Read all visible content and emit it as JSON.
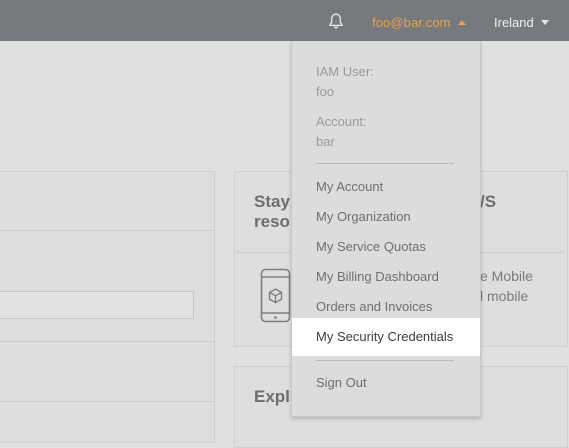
{
  "header": {
    "account_email": "foo@bar.com",
    "region": "Ireland",
    "icons": {
      "notifications": "bell-icon",
      "account_caret": "caret-up-icon",
      "region_caret": "caret-down-icon"
    },
    "colors": {
      "bar": "#76797d",
      "account": "#e3a253"
    }
  },
  "dropdown": {
    "iam_user_label": "IAM User:",
    "iam_user_value": "foo",
    "account_label": "Account:",
    "account_value": "bar",
    "items": [
      {
        "label": "My Account"
      },
      {
        "label": "My Organization"
      },
      {
        "label": "My Service Quotas"
      },
      {
        "label": "My Billing Dashboard"
      },
      {
        "label": "Orders and Invoices"
      },
      {
        "label": "My Security Credentials"
      }
    ],
    "sign_out": "Sign Out",
    "active_item": "My Security Credentials"
  },
  "background": {
    "card1_heading_line1": "Stay",
    "card1_heading_line1_end": "/S",
    "card1_heading_line2": "reso",
    "card1_text_line1": "e Mobile",
    "card1_text_line2": "l mobile",
    "card1_icon": "mobile-app-icon",
    "card2_heading": "Expl"
  }
}
